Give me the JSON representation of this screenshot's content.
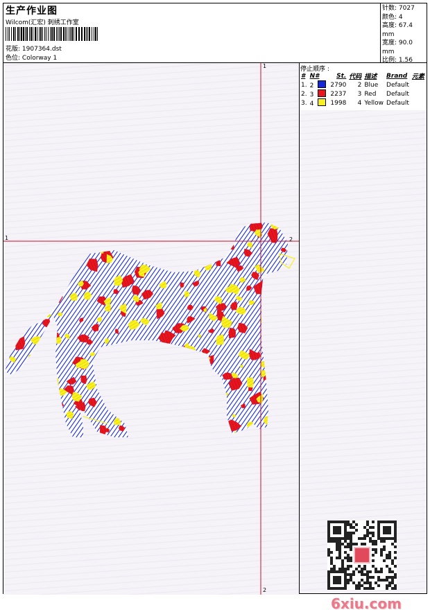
{
  "header": {
    "title": "生产作业图",
    "company": "Wilcom(汇宏) 刺绣工作室",
    "design_label": "花版:",
    "design_value": "1907364.dst",
    "colorway_label": "色位:",
    "colorway_value": "Colorway 1"
  },
  "stats": {
    "stitches": "针数: 7027",
    "colors": "颜色: 4",
    "height": "高度: 67.4 mm",
    "width": "宽度: 90.0 mm",
    "scale": "比例: 1.56"
  },
  "stop_sequence": {
    "title": "停止顺序 :",
    "headers": [
      "#",
      "N#",
      "St.",
      "代码",
      "描述",
      "Brand",
      "元素"
    ],
    "rows": [
      {
        "index": "1.",
        "needle": "2",
        "stitches": "2790",
        "code": "2",
        "description": "Blue",
        "brand": "Default",
        "color": "#1428d8"
      },
      {
        "index": "2.",
        "needle": "3",
        "stitches": "2237",
        "code": "3",
        "description": "Red",
        "brand": "Default",
        "color": "#e8141e"
      },
      {
        "index": "3.",
        "needle": "4",
        "stitches": "1998",
        "code": "4",
        "description": "Yellow",
        "brand": "Default",
        "color": "#f8f020"
      }
    ]
  },
  "markers": {
    "top": "1",
    "left": "1",
    "right": "2",
    "bottom": "2"
  },
  "watermark": {
    "site": "6xiu.com"
  },
  "colors": {
    "guide_line": "#c8102e",
    "blue": "#1428d8",
    "red": "#e8141e",
    "yellow": "#f8f020"
  }
}
